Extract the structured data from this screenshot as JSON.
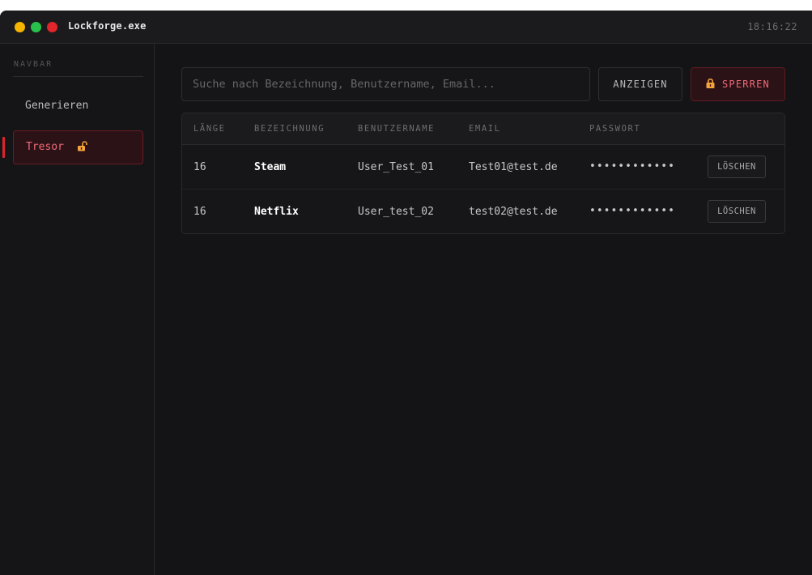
{
  "window": {
    "title": "Lockforge.exe",
    "clock": "18:16:22"
  },
  "sidebar": {
    "heading": "NAVBAR",
    "items": [
      {
        "label": "Generieren",
        "active": false
      },
      {
        "label": "Tresor",
        "active": true,
        "icon": "lock-open-icon"
      }
    ]
  },
  "toolbar": {
    "search_placeholder": "Suche nach Bezeichnung, Benutzername, Email...",
    "show_label": "ANZEIGEN",
    "lock_label": "SPERREN",
    "lock_icon": "lock-icon"
  },
  "table": {
    "headers": [
      "LÄNGE",
      "BEZEICHNUNG",
      "BENUTZERNAME",
      "EMAIL",
      "PASSWORT"
    ],
    "rows": [
      {
        "length": "16",
        "name": "Steam",
        "username": "User_Test_01",
        "email": "Test01@test.de",
        "password": "••••••••••••",
        "delete_label": "LÖSCHEN"
      },
      {
        "length": "16",
        "name": "Netflix",
        "username": "User_test_02",
        "email": "test02@test.de",
        "password": "••••••••••••",
        "delete_label": "LÖSCHEN"
      }
    ]
  },
  "colors": {
    "accent": "#e0252b",
    "accent_text": "#f06a78",
    "lock_icon": "#f4a23a",
    "window_bg": "#141416"
  }
}
